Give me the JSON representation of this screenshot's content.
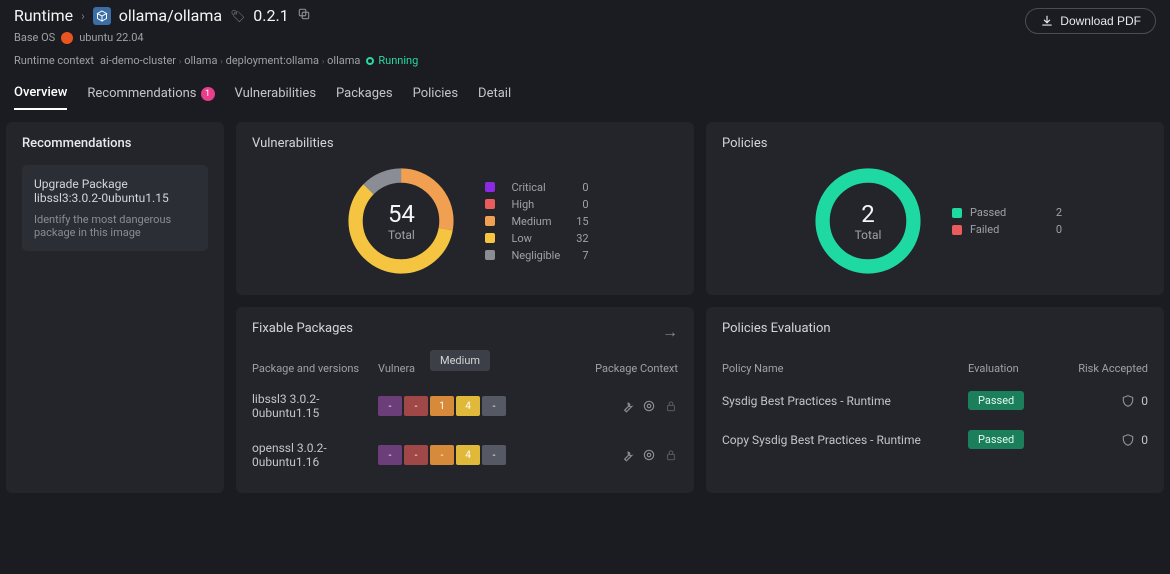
{
  "header": {
    "section": "Runtime",
    "image": "ollama/ollama",
    "version": "0.2.1",
    "base_os_label": "Base OS",
    "base_os_value": "ubuntu 22.04",
    "download_btn": "Download PDF"
  },
  "context": {
    "label": "Runtime context",
    "path": [
      "ai-demo-cluster",
      "ollama",
      "deployment:ollama",
      "ollama"
    ],
    "status": "Running"
  },
  "tabs": [
    {
      "label": "Overview",
      "active": true
    },
    {
      "label": "Recommendations",
      "badge": "1"
    },
    {
      "label": "Vulnerabilities"
    },
    {
      "label": "Packages"
    },
    {
      "label": "Policies"
    },
    {
      "label": "Detail"
    }
  ],
  "recommendations": {
    "title": "Recommendations",
    "item": {
      "title": "Upgrade Package libssl3:3.0.2-0ubuntu1.15",
      "sub": "Identify the most dangerous package in this image"
    }
  },
  "vuln": {
    "title": "Vulnerabilities",
    "total_label": "Total",
    "total": 54,
    "legend": [
      {
        "name": "Critical",
        "color": "#8a2be2",
        "count": 0
      },
      {
        "name": "High",
        "color": "#e85c5c",
        "count": 0
      },
      {
        "name": "Medium",
        "color": "#f0a050",
        "count": 15
      },
      {
        "name": "Low",
        "color": "#f5c542",
        "count": 32
      },
      {
        "name": "Negligible",
        "color": "#8a8d94",
        "count": 7
      }
    ]
  },
  "policies": {
    "title": "Policies",
    "total_label": "Total",
    "total": 2,
    "legend": [
      {
        "name": "Passed",
        "color": "#1fd9a3",
        "count": 2
      },
      {
        "name": "Failed",
        "color": "#e85c5c",
        "count": 0
      }
    ]
  },
  "fixable": {
    "title": "Fixable Packages",
    "cols": {
      "pkg": "Package and versions",
      "vuln": "Vulnera",
      "ctx": "Package Context"
    },
    "tooltip": "Medium",
    "rows": [
      {
        "pkg": "libssl3 3.0.2-0ubuntu1.15",
        "cells": [
          {
            "val": "-",
            "color": "#6b3e7a"
          },
          {
            "val": "-",
            "color": "#a04848"
          },
          {
            "val": "1",
            "color": "#d68a3a"
          },
          {
            "val": "4",
            "color": "#e0b83a"
          },
          {
            "val": "-",
            "color": "#555964"
          }
        ]
      },
      {
        "pkg": "openssl 3.0.2-0ubuntu1.16",
        "cells": [
          {
            "val": "-",
            "color": "#6b3e7a"
          },
          {
            "val": "-",
            "color": "#a04848"
          },
          {
            "val": "-",
            "color": "#d68a3a"
          },
          {
            "val": "4",
            "color": "#e0b83a"
          },
          {
            "val": "-",
            "color": "#555964"
          }
        ]
      }
    ]
  },
  "peval": {
    "title": "Policies Evaluation",
    "cols": {
      "name": "Policy Name",
      "eval": "Evaluation",
      "risk": "Risk Accepted"
    },
    "rows": [
      {
        "name": "Sysdig Best Practices - Runtime",
        "eval": "Passed",
        "risk": 0
      },
      {
        "name": "Copy Sysdig Best Practices - Runtime",
        "eval": "Passed",
        "risk": 0
      }
    ]
  },
  "chart_data": [
    {
      "type": "pie",
      "title": "Vulnerabilities",
      "categories": [
        "Critical",
        "High",
        "Medium",
        "Low",
        "Negligible"
      ],
      "values": [
        0,
        0,
        15,
        32,
        7
      ],
      "total": 54
    },
    {
      "type": "pie",
      "title": "Policies",
      "categories": [
        "Passed",
        "Failed"
      ],
      "values": [
        2,
        0
      ],
      "total": 2
    }
  ]
}
